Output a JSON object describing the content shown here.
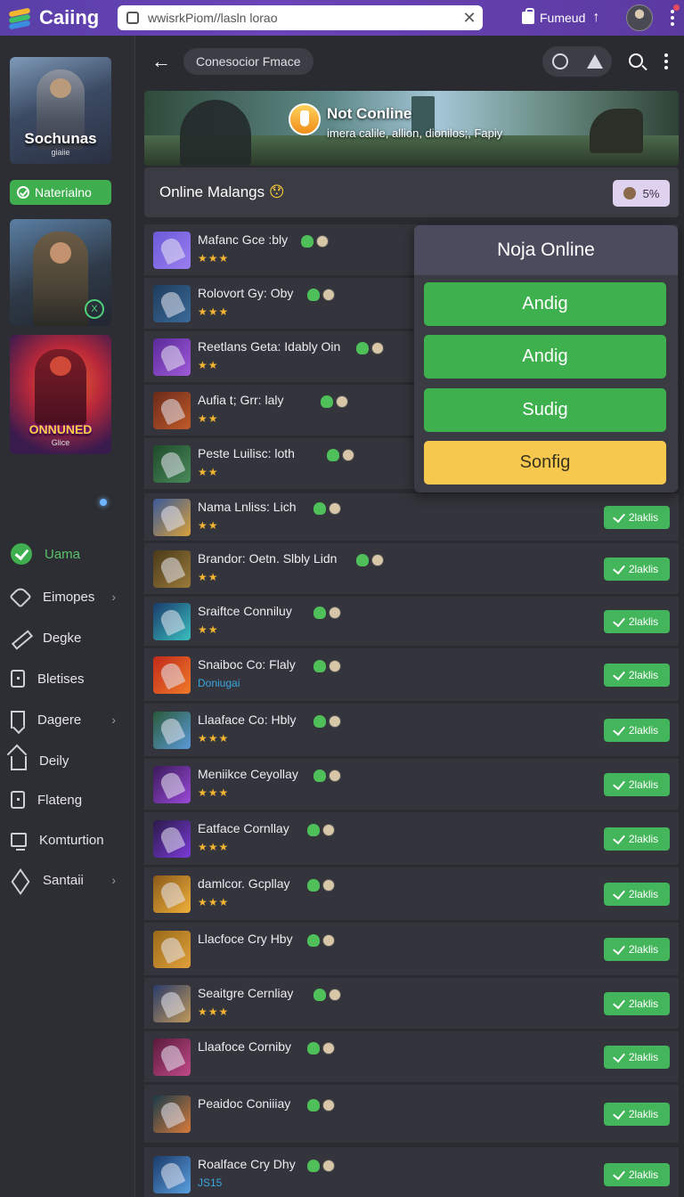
{
  "app": {
    "name": "Caiing",
    "url": "wwisrkPiom//lasln lorao",
    "action_label": "Fumeud"
  },
  "sidebar": {
    "covers": [
      {
        "title": "Sochunas",
        "subtitle": "giaiie"
      },
      {
        "title": "",
        "subtitle": "",
        "badge": "X"
      },
      {
        "title": "ONNUNED",
        "subtitle": "Glice"
      }
    ],
    "tag_button": "Naterialno",
    "nav": [
      {
        "label": "Uama",
        "icon": "check-icon",
        "active": true
      },
      {
        "label": "Eimopes",
        "icon": "tag-icon",
        "chevron": true
      },
      {
        "label": "Degke",
        "icon": "pencil-icon"
      },
      {
        "label": "Bletises",
        "icon": "document-icon"
      },
      {
        "label": "Dagere",
        "icon": "bookmark-icon",
        "chevron": true
      },
      {
        "label": "Deily",
        "icon": "home-icon"
      },
      {
        "label": "Flateng",
        "icon": "document-icon"
      },
      {
        "label": "Komturtion",
        "icon": "screen-icon"
      },
      {
        "label": "Santaii",
        "icon": "layers-icon",
        "chevron": true
      }
    ]
  },
  "toolbar": {
    "crumb": "Conesocior Fmace"
  },
  "banner": {
    "title": "Not Conline",
    "subtitle": "imera calile, allion, dionilos;, Fapiy"
  },
  "section": {
    "title": "Online Malangs",
    "emoji": "😯",
    "chip": "5%"
  },
  "popup": {
    "title": "Noja Online",
    "buttons": [
      "Andig",
      "Andig",
      "Sudig",
      "Sonfig"
    ]
  },
  "rows": [
    {
      "name": "Mafanc Gce :bly",
      "meta": "★★★"
    },
    {
      "name": "Rolovort Gy: Oby",
      "meta": "★★★"
    },
    {
      "name": "Reetlans Geta: Idably Oin",
      "meta": "★★"
    },
    {
      "name": "Aufia t; Grr: laly",
      "meta": "★★"
    },
    {
      "name": "Peste Luilisc: loth",
      "meta": "★★"
    },
    {
      "name": "Nama Lnliss: Lich",
      "meta": "★★",
      "button": "2laklis"
    },
    {
      "name": "Brandor: Oetn. Slbly Lidn",
      "meta": "★★",
      "button": "2laklis"
    },
    {
      "name": "Sraiftce Conniluy",
      "meta": "★★",
      "button": "2laklis"
    },
    {
      "name": "Snaiboc Co: Flaly",
      "meta": "Doniugai",
      "button": "2laklis"
    },
    {
      "name": "Llaaface Co: Hbly",
      "meta": "★★★",
      "button": "2laklis"
    },
    {
      "name": "Meniikce Ceyollay",
      "meta": "★★★",
      "button": "2laklis"
    },
    {
      "name": "Eatface Cornllay",
      "meta": "★★★",
      "button": "2laklis"
    },
    {
      "name": "damlcor. Gcpllay",
      "meta": "★★★",
      "button": "2laklis"
    },
    {
      "name": "Llacfoce Cry Hby",
      "meta": "",
      "button": "2laklis"
    },
    {
      "name": "Seaitgre Cernliay",
      "meta": "★★★",
      "button": "2laklis"
    },
    {
      "name": "Llaafoce Corniby",
      "meta": "",
      "button": "2laklis"
    },
    {
      "name": "Peaidoc Coniiiay",
      "meta": "",
      "button": "2laklis"
    },
    {
      "name": "Roalface Cry Dhy",
      "meta": "JS15",
      "button": "2laklis"
    }
  ],
  "colors": {
    "accent_purple": "#5a3fa8",
    "green": "#43b55a",
    "yellow": "#f6c84d",
    "background": "#2a2b31"
  }
}
